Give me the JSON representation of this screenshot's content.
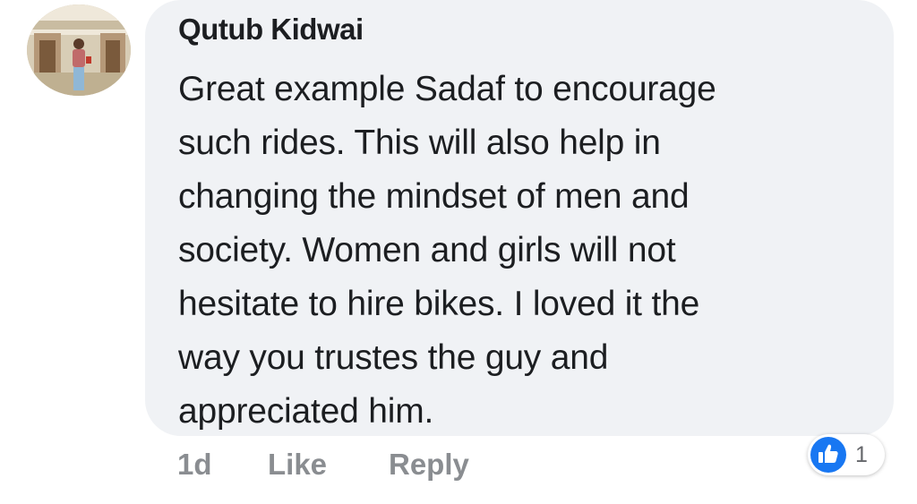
{
  "comment": {
    "author": "Qutub Kidwai",
    "text_lines": [
      "Great example Sadaf to encourage",
      "such rides. This will also help in",
      "changing the mindset of men and",
      "society. Women and girls will not",
      "hesitate to hire bikes. I loved it the",
      "way you trustes the guy and",
      "appreciated him."
    ],
    "time": "1d",
    "like_label": "Like",
    "reply_label": "Reply",
    "reaction_icon": "thumbs-up-icon",
    "reaction_count": "1"
  },
  "colors": {
    "bubble": "#f0f2f5",
    "text": "#1c1e21",
    "secondary": "#8a8d91",
    "like_blue": "#1877f2"
  }
}
